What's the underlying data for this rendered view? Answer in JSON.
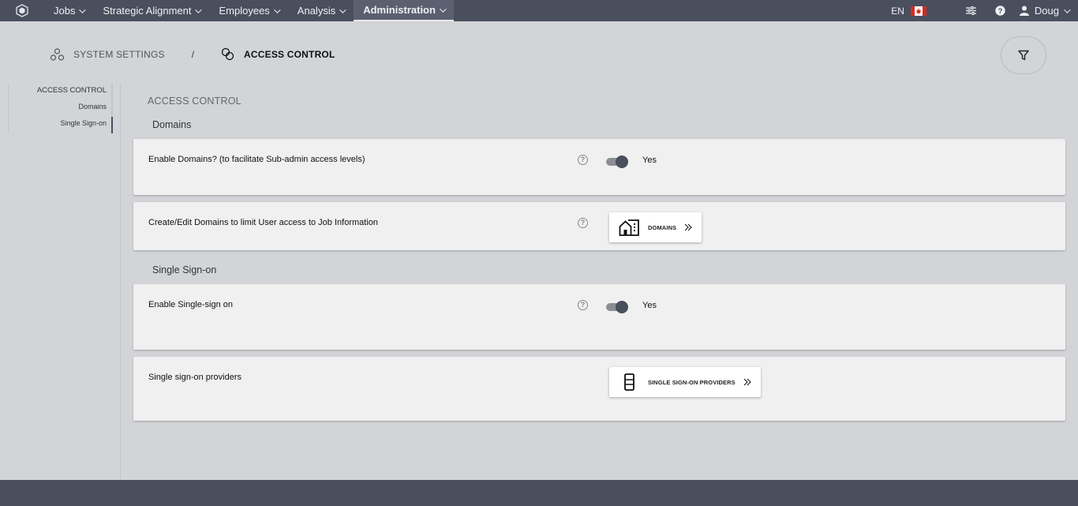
{
  "nav": {
    "items": [
      "Jobs",
      "Strategic Alignment",
      "Employees",
      "Analysis"
    ],
    "active": "Administration",
    "lang": "EN",
    "user": "Doug"
  },
  "breadcrumb": {
    "parent": "SYSTEM SETTINGS",
    "separator": "/",
    "current": "ACCESS CONTROL"
  },
  "sidebar": {
    "header": "ACCESS CONTROL",
    "items": [
      "Domains",
      "Single Sign-on"
    ]
  },
  "main": {
    "section_title": "ACCESS CONTROL",
    "groups": {
      "domains": "Domains",
      "sso": "Single Sign-on"
    },
    "rows": {
      "enable_domains": {
        "label": "Enable Domains? (to facilitate Sub-admin access levels)",
        "value": "Yes",
        "help": "?"
      },
      "edit_domains": {
        "label": "Create/Edit Domains to limit User access to Job Information",
        "button": "DOMAINS",
        "help": "?"
      },
      "enable_sso": {
        "label": "Enable Single-sign on",
        "value": "Yes",
        "help": "?"
      },
      "sso_providers": {
        "label": "Single sign-on providers",
        "button": "SINGLE SIGN-ON PROVIDERS"
      }
    }
  },
  "colors": {
    "topbar": "#4a4f5e",
    "background": "#d2d4d7",
    "card": "#f0f0f0"
  }
}
